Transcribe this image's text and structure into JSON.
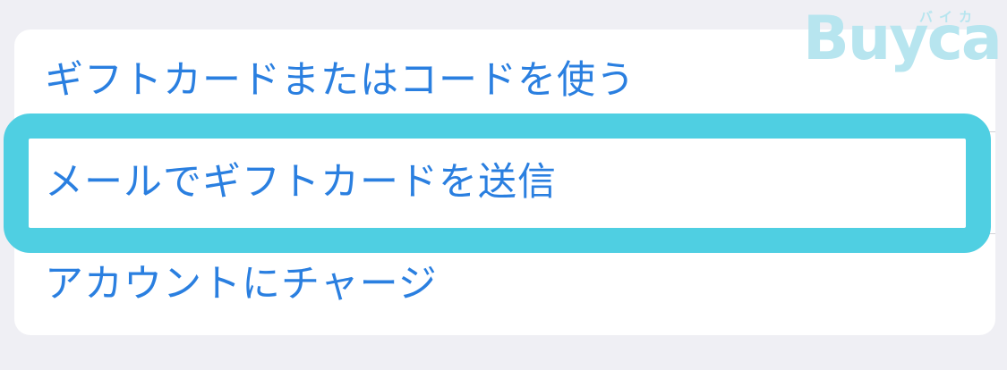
{
  "menu": {
    "items": [
      {
        "label": "ギフトカードまたはコードを使う"
      },
      {
        "label": "メールでギフトカードを送信"
      },
      {
        "label": "アカウントにチャージ"
      }
    ],
    "highlighted_index": 1
  },
  "watermark": {
    "brand": "Buyca",
    "reading": "バイカ"
  },
  "colors": {
    "background": "#efeff4",
    "card": "#ffffff",
    "link_text": "#2a7fe0",
    "highlight": "#4fcfe2",
    "watermark": "#b7e5ef"
  }
}
